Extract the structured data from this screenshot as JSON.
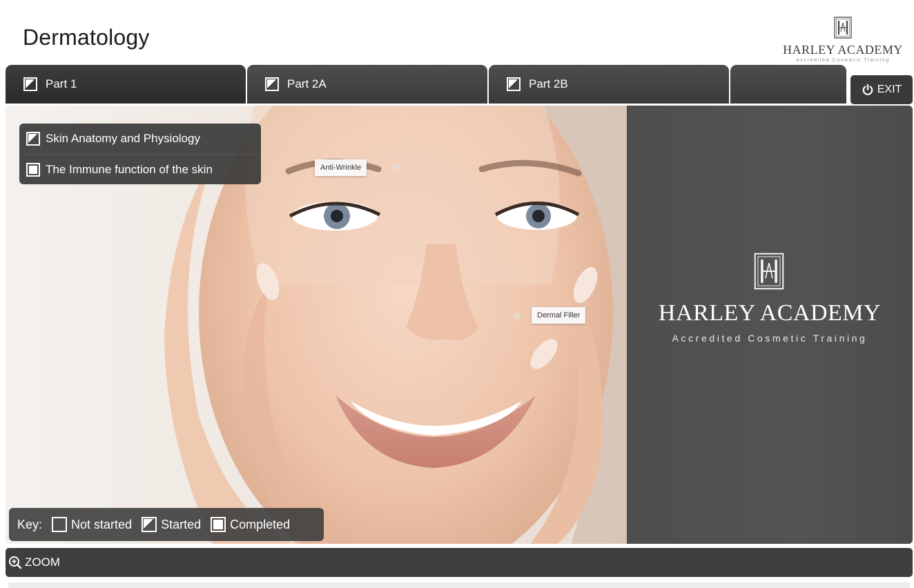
{
  "header": {
    "title": "Dermatology"
  },
  "brand": {
    "name": "HARLEY ACADEMY",
    "tagline": "Accredited Cosmetic Training",
    "logo_icon": "harley-monogram-icon"
  },
  "tabs": [
    {
      "label": "Part 1",
      "status": "started",
      "active": true
    },
    {
      "label": "Part 2A",
      "status": "started",
      "active": false
    },
    {
      "label": "Part 2B",
      "status": "started",
      "active": false
    }
  ],
  "exit": {
    "label": "EXIT",
    "icon": "power-icon"
  },
  "topics": [
    {
      "label": "Skin Anatomy and Physiology",
      "status": "started"
    },
    {
      "label": "The Immune function of the skin",
      "status": "completed"
    }
  ],
  "hotspots": [
    {
      "label": "Anti-Wrinkle"
    },
    {
      "label": "Dermal Filler"
    }
  ],
  "key": {
    "label": "Key:",
    "items": [
      {
        "label": "Not started",
        "status": "not-started"
      },
      {
        "label": "Started",
        "status": "started"
      },
      {
        "label": "Completed",
        "status": "completed"
      }
    ]
  },
  "zoom": {
    "label": "ZOOM",
    "icon": "zoom-in-icon"
  },
  "colors": {
    "bar_dark": "#3a3a3a",
    "panel_grey": "#505050",
    "page_bg": "#ffffff"
  }
}
